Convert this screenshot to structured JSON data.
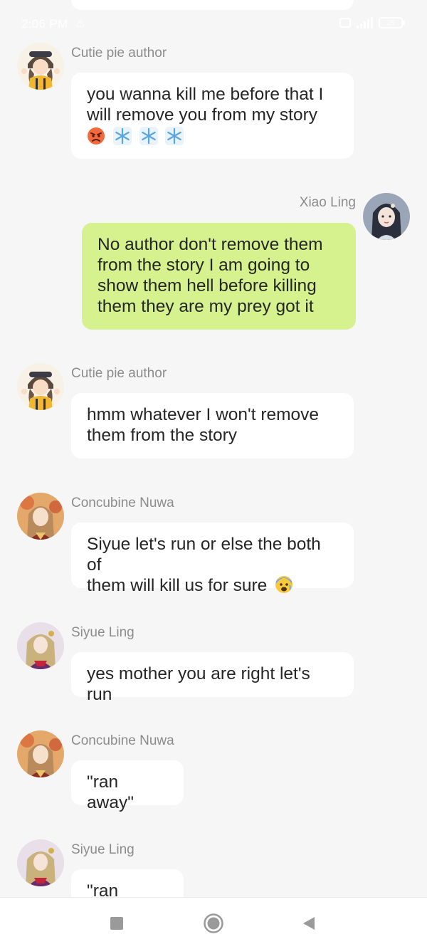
{
  "status_bar": {
    "time": "2:06 PM",
    "battery": "25"
  },
  "messages": [
    {
      "sender": "Cutie pie author",
      "lines": [
        "you wanna kill me before that I",
        "will remove you from my story"
      ],
      "emoji": [
        "angry-face-emoji",
        "snowflake-emoji",
        "snowflake-emoji",
        "snowflake-emoji"
      ]
    },
    {
      "sender": "Xiao Ling",
      "lines": [
        "No author don't remove them",
        "from the story I am going to",
        "show them hell before killing",
        "them they are my prey got it"
      ]
    },
    {
      "sender": "Cutie pie author",
      "lines": [
        "hmm whatever I won't remove",
        "them from the story"
      ]
    },
    {
      "sender": "Concubine Nuwa",
      "lines": [
        "Siyue let's run or else the both of",
        "them will kill us for sure"
      ],
      "emoji": [
        "anxious-face-emoji"
      ]
    },
    {
      "sender": "Siyue Ling",
      "lines": [
        "yes mother you are right let's run"
      ]
    },
    {
      "sender": "Concubine Nuwa",
      "lines": [
        "\"ran away\""
      ]
    },
    {
      "sender": "Siyue Ling",
      "lines": [
        "\"ran away\""
      ]
    }
  ],
  "nav_bar": {
    "icons": [
      "recents-square-icon",
      "home-circle-icon",
      "back-triangle-icon"
    ]
  },
  "colors": {
    "background": "#f6f6f6",
    "bubble_other": "#ffffff",
    "bubble_own": "#d6f28e",
    "sender_name": "#8c8c8c"
  }
}
